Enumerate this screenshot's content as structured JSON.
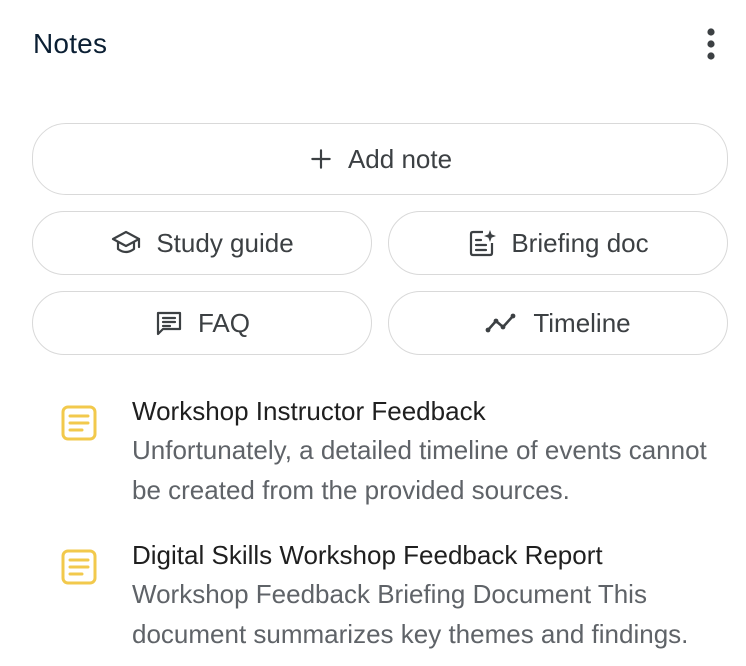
{
  "header": {
    "title": "Notes",
    "more_icon": "more-vert-icon"
  },
  "actions": {
    "add_note": {
      "label": "Add note",
      "icon": "plus-icon"
    },
    "study_guide": {
      "label": "Study guide",
      "icon": "graduation-cap-icon"
    },
    "briefing_doc": {
      "label": "Briefing doc",
      "icon": "document-sparkle-icon"
    },
    "faq": {
      "label": "FAQ",
      "icon": "chat-lines-icon"
    },
    "timeline": {
      "label": "Timeline",
      "icon": "trend-line-icon"
    }
  },
  "notes": [
    {
      "title": "Workshop Instructor Feedback",
      "preview": "Unfortunately, a detailed timeline of events cannot be created from the provided sources.",
      "icon": "note-icon"
    },
    {
      "title": "Digital Skills Workshop Feedback Report",
      "preview": "Workshop Feedback Briefing Document This document summarizes key themes and findings.",
      "icon": "note-icon"
    }
  ],
  "colors": {
    "note_icon": "#f2c94c",
    "border": "#d9d9d9",
    "title": "#0b1f33",
    "secondary_text": "#5f6368"
  }
}
